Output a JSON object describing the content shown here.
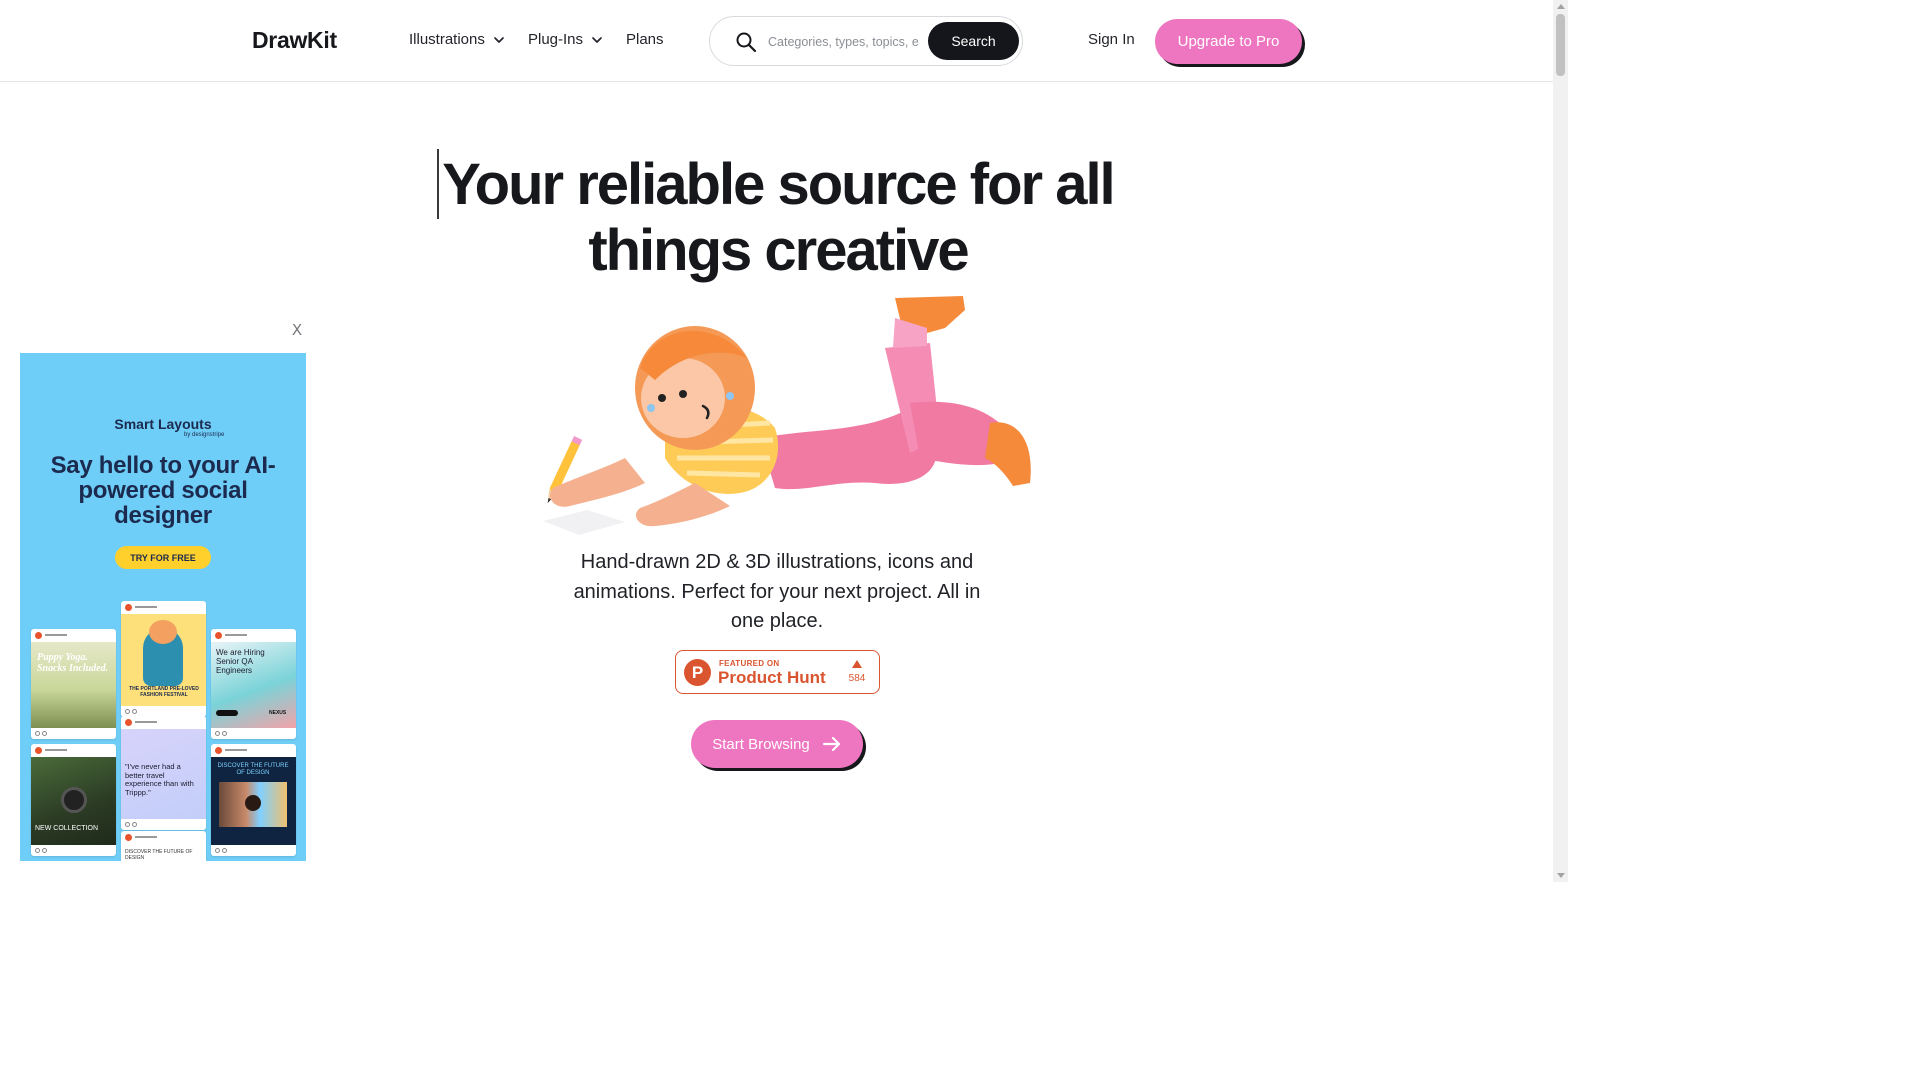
{
  "header": {
    "logo": "DrawKit",
    "nav": [
      {
        "label": "Illustrations"
      },
      {
        "label": "Plug-Ins"
      },
      {
        "label": "Plans"
      }
    ],
    "search": {
      "placeholder": "Categories, types, topics, et",
      "button_label": "Search"
    },
    "sign_in": "Sign In",
    "upgrade": "Upgrade to Pro"
  },
  "hero": {
    "title": "Your reliable source for all things creative",
    "subtitle": "Hand-drawn 2D & 3D illustrations, icons and animations. Perfect for your next project. All in one place.",
    "product_hunt": {
      "featured": "FEATURED ON",
      "name": "Product Hunt",
      "logo_letter": "P",
      "votes": "584"
    },
    "cta": "Start Browsing"
  },
  "ad": {
    "close_label": "X",
    "brand": "Smart Layouts",
    "brand_by": "by designstripe",
    "headline": "Say hello to your AI-powered social designer",
    "cta": "TRY FOR FREE",
    "cards": {
      "puppy": "Puppy Yoga. Snacks Included.",
      "fashion": "THE PORTLAND PRE-LOVED FASHION FESTIVAL",
      "hiring": "We are Hiring Senior QA Engineers",
      "hiring_brand": "NEXUS",
      "watch": "NEW COLLECTION",
      "travel": "\"I've never had a better travel experience than with Trippp.\"",
      "future": "DISCOVER THE FUTURE OF DESIGN",
      "future_small": "DISCOVER THE FUTURE OF DESIGN"
    }
  },
  "colors": {
    "accent_pink": "#ee75c0",
    "dark": "#14161b",
    "product_hunt": "#da552f",
    "ad_bg": "#6fcef7",
    "ad_cta": "#ffd02b"
  }
}
